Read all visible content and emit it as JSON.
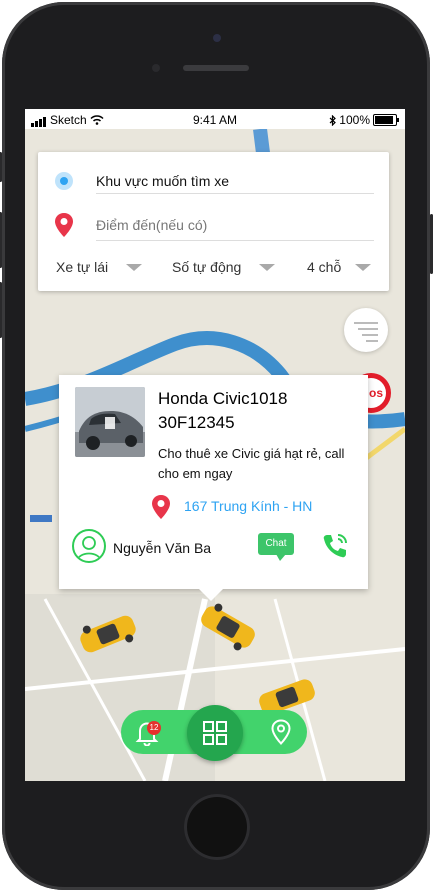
{
  "status": {
    "carrier": "Sketch",
    "time": "9:41 AM",
    "battery": "100%"
  },
  "search": {
    "pickup": "Khu vực muốn tìm xe",
    "destination_placeholder": "Điểm đến(nếu có)",
    "filters": [
      "Xe tự lái",
      "Số tự động",
      "4 chỗ"
    ]
  },
  "map_badge": "os",
  "card": {
    "title": "Honda Civic1018\n30F12345",
    "description": "Cho thuê xe Civic giá hạt rẻ, call cho em ngay",
    "address": "167 Trung Kính - HN",
    "owner": "Nguyễn Văn Ba",
    "chat": "Chat"
  },
  "nav": {
    "notifications": "12"
  },
  "colors": {
    "green": "#42d36c",
    "dark_green": "#24a64e",
    "blue": "#2ea3f2",
    "red": "#e8354a"
  }
}
